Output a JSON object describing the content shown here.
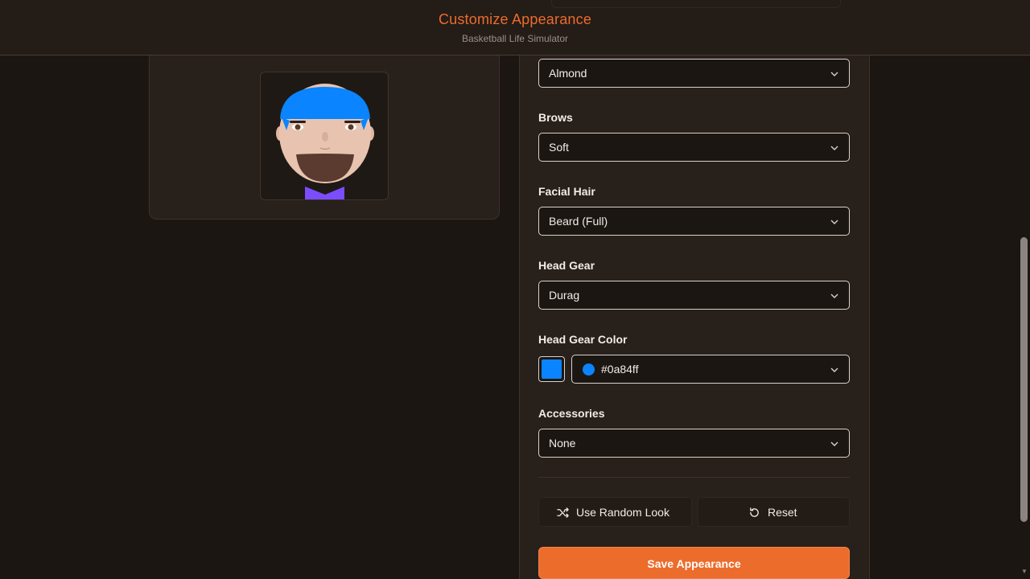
{
  "header": {
    "title": "Customize Appearance",
    "subtitle": "Basketball Life Simulator"
  },
  "preview": {
    "avatar_colors": {
      "skin": "#e8c4b0",
      "headgear": "#0a84ff",
      "shirt": "#7b4dff",
      "mouth": "#5b3b2f"
    }
  },
  "form": {
    "eyes": {
      "value": "Almond"
    },
    "brows": {
      "label": "Brows",
      "value": "Soft"
    },
    "facial_hair": {
      "label": "Facial Hair",
      "value": "Beard (Full)"
    },
    "head_gear": {
      "label": "Head Gear",
      "value": "Durag"
    },
    "head_gear_color": {
      "label": "Head Gear Color",
      "value": "#0a84ff"
    },
    "accessories": {
      "label": "Accessories",
      "value": "None"
    }
  },
  "actions": {
    "random_label": "Use Random Look",
    "reset_label": "Reset",
    "save_label": "Save Appearance"
  },
  "colors": {
    "accent": "#ec6c2c",
    "background": "#1c1612",
    "panel": "#27201b"
  }
}
